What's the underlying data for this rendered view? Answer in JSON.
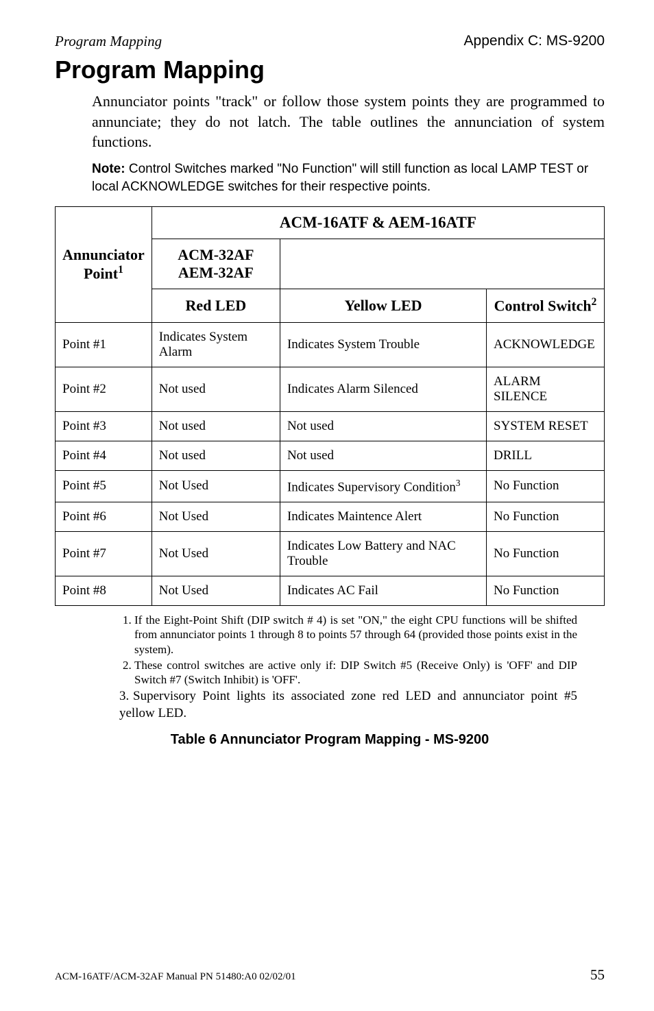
{
  "header": {
    "left": "Program Mapping",
    "right": "Appendix C: MS-9200"
  },
  "title": "Program Mapping",
  "intro": "Annunciator points \"track\" or follow those system points they are programmed to annunciate; they do not latch. The table outlines the annunciation of system functions.",
  "note_label": "Note:",
  "note_text": " Control Switches marked \"No Function\" will still function as local LAMP TEST or local ACKNOWLEDGE switches for their respective points.",
  "table": {
    "span_header": "ACM-16ATF & AEM-16ATF",
    "row_header_line1": "Annunciator",
    "row_header_line2": "Point",
    "row_header_sup": "1",
    "sub_header_line1": "ACM-32AF",
    "sub_header_line2": "AEM-32AF",
    "col_red": "Red LED",
    "col_yellow": "Yellow LED",
    "col_ctrl": "Control Switch",
    "col_ctrl_sup": "2",
    "rows": [
      {
        "p": "Point #1",
        "red": "Indicates System Alarm",
        "yellow": "Indicates System Trouble",
        "ctrl": "ACKNOWLEDGE"
      },
      {
        "p": "Point #2",
        "red": "Not used",
        "yellow": "Indicates Alarm Silenced",
        "ctrl": "ALARM SILENCE"
      },
      {
        "p": "Point #3",
        "red": "Not used",
        "yellow": "Not used",
        "ctrl": "SYSTEM RESET"
      },
      {
        "p": "Point #4",
        "red": "Not used",
        "yellow": "Not used",
        "ctrl": "DRILL"
      },
      {
        "p": "Point #5",
        "red": "Not Used",
        "yellow": "Indicates Supervisory Condition",
        "yellow_sup": "3",
        "ctrl": "No Function"
      },
      {
        "p": "Point #6",
        "red": "Not Used",
        "yellow": "Indicates Maintence Alert",
        "ctrl": "No Function"
      },
      {
        "p": "Point #7",
        "red": "Not Used",
        "yellow": "Indicates Low Battery and NAC Trouble",
        "ctrl": "No Function"
      },
      {
        "p": "Point #8",
        "red": "Not Used",
        "yellow": "Indicates AC Fail",
        "ctrl": "No Function"
      }
    ]
  },
  "footnotes": {
    "f1": "If the Eight-Point Shift (DIP switch # 4) is set \"ON,\" the eight CPU functions will be shifted from annunciator points 1 through 8 to points 57 through 64 (provided those points exist in the system).",
    "f2": "These control switches are active only if: DIP Switch #5 (Receive Only) is 'OFF' and DIP Switch #7 (Switch Inhibit) is 'OFF'.",
    "f3": "Supervisory Point lights its associated zone red LED and annunciator point #5 yellow LED."
  },
  "caption": "Table 6  Annunciator Program Mapping - MS-9200",
  "footer": {
    "left": "ACM-16ATF/ACM-32AF Manual  PN 51480:A0  02/02/01",
    "right": "55"
  }
}
